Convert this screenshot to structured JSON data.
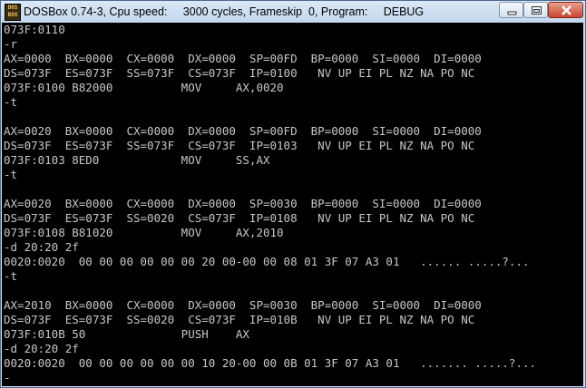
{
  "window": {
    "title": "DOSBox 0.74-3, Cpu speed:     3000 cycles, Frameskip  0, Program:     DEBUG",
    "icon_text_top": "DOS",
    "icon_text_bottom": "BOX"
  },
  "console": {
    "lines": [
      "073F:0110",
      "-r",
      "AX=0000  BX=0000  CX=0000  DX=0000  SP=00FD  BP=0000  SI=0000  DI=0000",
      "DS=073F  ES=073F  SS=073F  CS=073F  IP=0100   NV UP EI PL NZ NA PO NC",
      "073F:0100 B82000          MOV     AX,0020",
      "-t",
      "",
      "AX=0020  BX=0000  CX=0000  DX=0000  SP=00FD  BP=0000  SI=0000  DI=0000",
      "DS=073F  ES=073F  SS=073F  CS=073F  IP=0103   NV UP EI PL NZ NA PO NC",
      "073F:0103 8ED0            MOV     SS,AX",
      "-t",
      "",
      "AX=0020  BX=0000  CX=0000  DX=0000  SP=0030  BP=0000  SI=0000  DI=0000",
      "DS=073F  ES=073F  SS=0020  CS=073F  IP=0108   NV UP EI PL NZ NA PO NC",
      "073F:0108 B81020          MOV     AX,2010",
      "-d 20:20 2f",
      "0020:0020  00 00 00 00 00 00 20 00-00 00 08 01 3F 07 A3 01   ...... .....?...",
      "-t",
      "",
      "AX=2010  BX=0000  CX=0000  DX=0000  SP=0030  BP=0000  SI=0000  DI=0000",
      "DS=073F  ES=073F  SS=0020  CS=073F  IP=010B   NV UP EI PL NZ NA PO NC",
      "073F:010B 50              PUSH    AX",
      "-d 20:20 2f",
      "0020:0020  00 00 00 00 00 00 10 20-00 00 0B 01 3F 07 A3 01   ....... .....?...",
      "-"
    ]
  }
}
